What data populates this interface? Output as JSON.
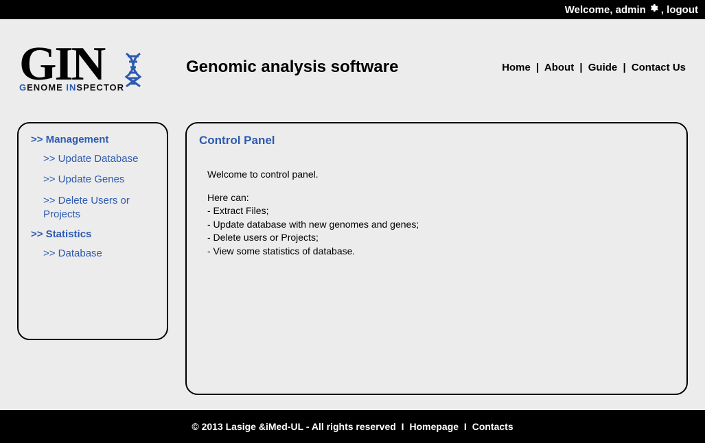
{
  "topbar": {
    "welcome": "Welcome, admin",
    "logout": ", logout"
  },
  "logo": {
    "main": "GIN",
    "sub_g": "G",
    "sub_enome": "ENOME ",
    "sub_in": "IN",
    "sub_spector": "SPECTOR"
  },
  "tagline": "Genomic analysis software",
  "nav": {
    "home": "Home",
    "about": "About",
    "guide": "Guide",
    "contact": "Contact Us"
  },
  "sidebar": {
    "management": {
      "head": ">> Management",
      "update_db": ">> Update Database",
      "update_genes": ">> Update Genes",
      "delete_users": ">> Delete Users or Projects"
    },
    "statistics": {
      "head": ">> Statistics",
      "database": ">> Database"
    }
  },
  "content": {
    "title": "Control Panel",
    "welcome": "Welcome to control panel.",
    "here_can": "Here can:",
    "b1": "- Extract Files;",
    "b2": "- Update database with new genomes and genes;",
    "b3": "- Delete users or Projects;",
    "b4": "- View some statistics of database."
  },
  "footer": {
    "copy": "© 2013 Lasige &iMed-UL - All rights reserved",
    "homepage": "Homepage",
    "contacts": "Contacts"
  }
}
